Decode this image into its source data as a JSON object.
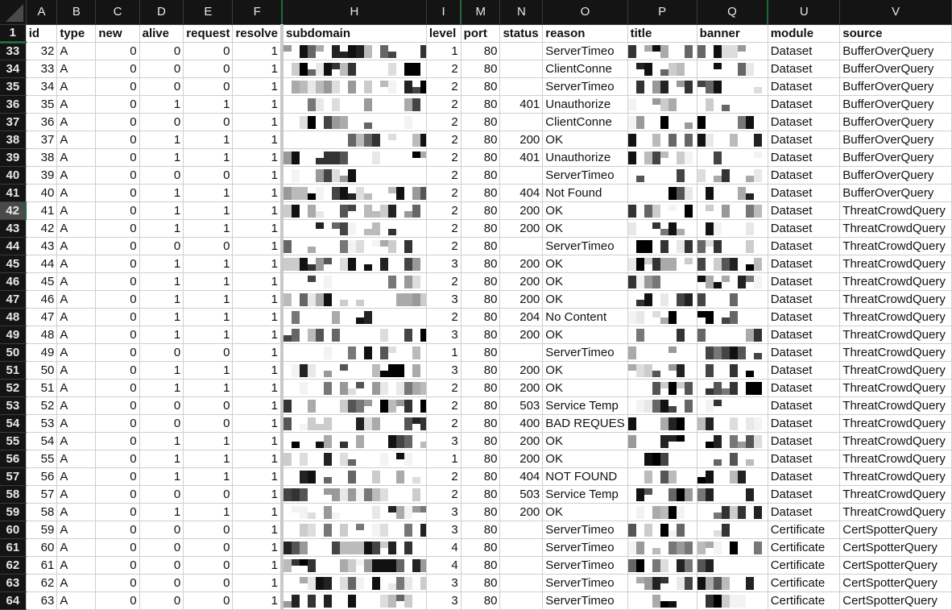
{
  "app": "Spreadsheet",
  "column_letters": [
    "A",
    "B",
    "C",
    "D",
    "E",
    "F",
    "H",
    "I",
    "M",
    "N",
    "O",
    "P",
    "Q",
    "U",
    "V"
  ],
  "header_row": {
    "row_number": "1",
    "labels": [
      "id",
      "type",
      "new",
      "alive",
      "request",
      "resolve",
      "subdomain",
      "level",
      "port",
      "status",
      "reason",
      "title",
      "banner",
      "module",
      "source"
    ]
  },
  "selected_row": "42",
  "redacted_columns": [
    "subdomain",
    "title",
    "banner"
  ],
  "rows": [
    {
      "rn": "33",
      "id": "32",
      "type": "A",
      "new": "0",
      "alive": "0",
      "request": "0",
      "resolve": "1",
      "level": "1",
      "port": "80",
      "status": "",
      "reason": "ServerTimeo",
      "module": "Dataset",
      "source": "BufferOverQuery"
    },
    {
      "rn": "34",
      "id": "33",
      "type": "A",
      "new": "0",
      "alive": "0",
      "request": "0",
      "resolve": "1",
      "level": "2",
      "port": "80",
      "status": "",
      "reason": "ClientConne",
      "module": "Dataset",
      "source": "BufferOverQuery"
    },
    {
      "rn": "35",
      "id": "34",
      "type": "A",
      "new": "0",
      "alive": "0",
      "request": "0",
      "resolve": "1",
      "level": "2",
      "port": "80",
      "status": "",
      "reason": "ServerTimeo",
      "module": "Dataset",
      "source": "BufferOverQuery"
    },
    {
      "rn": "36",
      "id": "35",
      "type": "A",
      "new": "0",
      "alive": "1",
      "request": "1",
      "resolve": "1",
      "level": "2",
      "port": "80",
      "status": "401",
      "reason": "Unauthorize",
      "module": "Dataset",
      "source": "BufferOverQuery"
    },
    {
      "rn": "37",
      "id": "36",
      "type": "A",
      "new": "0",
      "alive": "0",
      "request": "0",
      "resolve": "1",
      "level": "2",
      "port": "80",
      "status": "",
      "reason": "ClientConne",
      "module": "Dataset",
      "source": "BufferOverQuery"
    },
    {
      "rn": "38",
      "id": "37",
      "type": "A",
      "new": "0",
      "alive": "1",
      "request": "1",
      "resolve": "1",
      "level": "2",
      "port": "80",
      "status": "200",
      "reason": "OK",
      "module": "Dataset",
      "source": "BufferOverQuery"
    },
    {
      "rn": "39",
      "id": "38",
      "type": "A",
      "new": "0",
      "alive": "1",
      "request": "1",
      "resolve": "1",
      "level": "2",
      "port": "80",
      "status": "401",
      "reason": "Unauthorize",
      "module": "Dataset",
      "source": "BufferOverQuery"
    },
    {
      "rn": "40",
      "id": "39",
      "type": "A",
      "new": "0",
      "alive": "0",
      "request": "0",
      "resolve": "1",
      "level": "2",
      "port": "80",
      "status": "",
      "reason": "ServerTimeo",
      "module": "Dataset",
      "source": "BufferOverQuery"
    },
    {
      "rn": "41",
      "id": "40",
      "type": "A",
      "new": "0",
      "alive": "1",
      "request": "1",
      "resolve": "1",
      "level": "2",
      "port": "80",
      "status": "404",
      "reason": "Not Found",
      "module": "Dataset",
      "source": "BufferOverQuery"
    },
    {
      "rn": "42",
      "id": "41",
      "type": "A",
      "new": "0",
      "alive": "1",
      "request": "1",
      "resolve": "1",
      "level": "2",
      "port": "80",
      "status": "200",
      "reason": "OK",
      "module": "Dataset",
      "source": "ThreatCrowdQuery"
    },
    {
      "rn": "43",
      "id": "42",
      "type": "A",
      "new": "0",
      "alive": "1",
      "request": "1",
      "resolve": "1",
      "level": "2",
      "port": "80",
      "status": "200",
      "reason": "OK",
      "module": "Dataset",
      "source": "ThreatCrowdQuery"
    },
    {
      "rn": "44",
      "id": "43",
      "type": "A",
      "new": "0",
      "alive": "0",
      "request": "0",
      "resolve": "1",
      "level": "2",
      "port": "80",
      "status": "",
      "reason": "ServerTimeo",
      "module": "Dataset",
      "source": "ThreatCrowdQuery"
    },
    {
      "rn": "45",
      "id": "44",
      "type": "A",
      "new": "0",
      "alive": "1",
      "request": "1",
      "resolve": "1",
      "level": "3",
      "port": "80",
      "status": "200",
      "reason": "OK",
      "module": "Dataset",
      "source": "ThreatCrowdQuery"
    },
    {
      "rn": "46",
      "id": "45",
      "type": "A",
      "new": "0",
      "alive": "1",
      "request": "1",
      "resolve": "1",
      "level": "2",
      "port": "80",
      "status": "200",
      "reason": "OK",
      "module": "Dataset",
      "source": "ThreatCrowdQuery"
    },
    {
      "rn": "47",
      "id": "46",
      "type": "A",
      "new": "0",
      "alive": "1",
      "request": "1",
      "resolve": "1",
      "level": "3",
      "port": "80",
      "status": "200",
      "reason": "OK",
      "module": "Dataset",
      "source": "ThreatCrowdQuery"
    },
    {
      "rn": "48",
      "id": "47",
      "type": "A",
      "new": "0",
      "alive": "1",
      "request": "1",
      "resolve": "1",
      "level": "2",
      "port": "80",
      "status": "204",
      "reason": "No Content",
      "module": "Dataset",
      "source": "ThreatCrowdQuery"
    },
    {
      "rn": "49",
      "id": "48",
      "type": "A",
      "new": "0",
      "alive": "1",
      "request": "1",
      "resolve": "1",
      "level": "3",
      "port": "80",
      "status": "200",
      "reason": "OK",
      "module": "Dataset",
      "source": "ThreatCrowdQuery"
    },
    {
      "rn": "50",
      "id": "49",
      "type": "A",
      "new": "0",
      "alive": "0",
      "request": "0",
      "resolve": "1",
      "level": "1",
      "port": "80",
      "status": "",
      "reason": "ServerTimeo",
      "module": "Dataset",
      "source": "ThreatCrowdQuery"
    },
    {
      "rn": "51",
      "id": "50",
      "type": "A",
      "new": "0",
      "alive": "1",
      "request": "1",
      "resolve": "1",
      "level": "3",
      "port": "80",
      "status": "200",
      "reason": "OK",
      "module": "Dataset",
      "source": "ThreatCrowdQuery"
    },
    {
      "rn": "52",
      "id": "51",
      "type": "A",
      "new": "0",
      "alive": "1",
      "request": "1",
      "resolve": "1",
      "level": "2",
      "port": "80",
      "status": "200",
      "reason": "OK",
      "module": "Dataset",
      "source": "ThreatCrowdQuery"
    },
    {
      "rn": "53",
      "id": "52",
      "type": "A",
      "new": "0",
      "alive": "0",
      "request": "0",
      "resolve": "1",
      "level": "2",
      "port": "80",
      "status": "503",
      "reason": "Service Temp",
      "module": "Dataset",
      "source": "ThreatCrowdQuery"
    },
    {
      "rn": "54",
      "id": "53",
      "type": "A",
      "new": "0",
      "alive": "0",
      "request": "0",
      "resolve": "1",
      "level": "2",
      "port": "80",
      "status": "400",
      "reason": "BAD REQUES",
      "module": "Dataset",
      "source": "ThreatCrowdQuery"
    },
    {
      "rn": "55",
      "id": "54",
      "type": "A",
      "new": "0",
      "alive": "1",
      "request": "1",
      "resolve": "1",
      "level": "3",
      "port": "80",
      "status": "200",
      "reason": "OK",
      "module": "Dataset",
      "source": "ThreatCrowdQuery"
    },
    {
      "rn": "56",
      "id": "55",
      "type": "A",
      "new": "0",
      "alive": "1",
      "request": "1",
      "resolve": "1",
      "level": "1",
      "port": "80",
      "status": "200",
      "reason": "OK",
      "module": "Dataset",
      "source": "ThreatCrowdQuery"
    },
    {
      "rn": "57",
      "id": "56",
      "type": "A",
      "new": "0",
      "alive": "1",
      "request": "1",
      "resolve": "1",
      "level": "2",
      "port": "80",
      "status": "404",
      "reason": "NOT FOUND",
      "module": "Dataset",
      "source": "ThreatCrowdQuery"
    },
    {
      "rn": "58",
      "id": "57",
      "type": "A",
      "new": "0",
      "alive": "0",
      "request": "0",
      "resolve": "1",
      "level": "2",
      "port": "80",
      "status": "503",
      "reason": "Service Temp",
      "module": "Dataset",
      "source": "ThreatCrowdQuery"
    },
    {
      "rn": "59",
      "id": "58",
      "type": "A",
      "new": "0",
      "alive": "1",
      "request": "1",
      "resolve": "1",
      "level": "3",
      "port": "80",
      "status": "200",
      "reason": "OK",
      "module": "Dataset",
      "source": "ThreatCrowdQuery"
    },
    {
      "rn": "60",
      "id": "59",
      "type": "A",
      "new": "0",
      "alive": "0",
      "request": "0",
      "resolve": "1",
      "level": "3",
      "port": "80",
      "status": "",
      "reason": "ServerTimeo",
      "module": "Certificate",
      "source": "CertSpotterQuery"
    },
    {
      "rn": "61",
      "id": "60",
      "type": "A",
      "new": "0",
      "alive": "0",
      "request": "0",
      "resolve": "1",
      "level": "4",
      "port": "80",
      "status": "",
      "reason": "ServerTimeo",
      "module": "Certificate",
      "source": "CertSpotterQuery"
    },
    {
      "rn": "62",
      "id": "61",
      "type": "A",
      "new": "0",
      "alive": "0",
      "request": "0",
      "resolve": "1",
      "level": "4",
      "port": "80",
      "status": "",
      "reason": "ServerTimeo",
      "module": "Certificate",
      "source": "CertSpotterQuery"
    },
    {
      "rn": "63",
      "id": "62",
      "type": "A",
      "new": "0",
      "alive": "0",
      "request": "0",
      "resolve": "1",
      "level": "3",
      "port": "80",
      "status": "",
      "reason": "ServerTimeo",
      "module": "Certificate",
      "source": "CertSpotterQuery"
    },
    {
      "rn": "64",
      "id": "63",
      "type": "A",
      "new": "0",
      "alive": "0",
      "request": "0",
      "resolve": "1",
      "level": "3",
      "port": "80",
      "status": "",
      "reason": "ServerTimeo",
      "module": "Certificate",
      "source": "CertSpotterQuery"
    }
  ]
}
